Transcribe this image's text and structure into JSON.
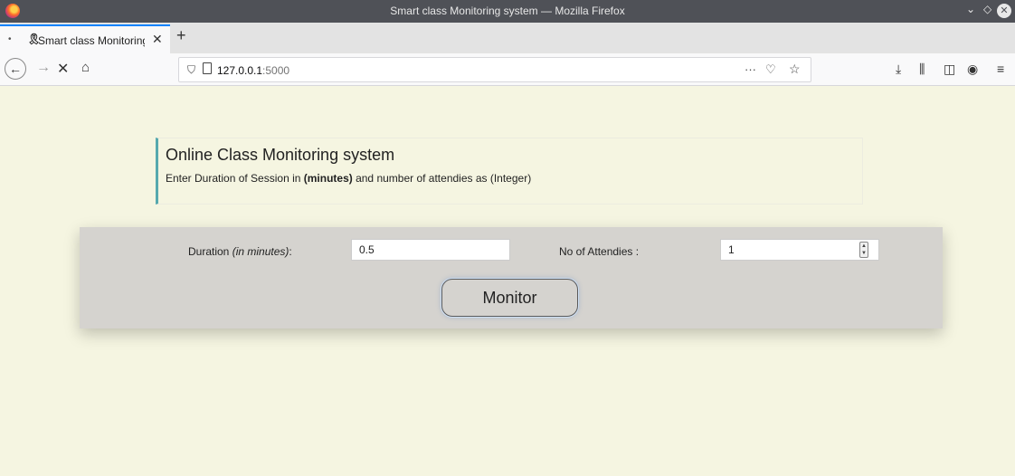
{
  "window": {
    "title": "Smart class Monitoring system — Mozilla Firefox"
  },
  "tabs": [
    {
      "label": "Smart class Monitoring",
      "active": true
    }
  ],
  "navbar": {
    "url_host": "127.0.0.1",
    "url_port": ":5000"
  },
  "page": {
    "heading": "Online Class Monitoring system",
    "instructions_pre": "Enter Duration of Session in ",
    "instructions_bold": "(minutes)",
    "instructions_post": " and number of attendies as (Integer)"
  },
  "form": {
    "duration_label": "Duration ",
    "duration_label_italic": "(in minutes)",
    "duration_label_suffix": ":",
    "duration_value": "0.5",
    "attendees_label": "No of Attendies :",
    "attendees_value": "1",
    "submit_label": "Monitor"
  },
  "colors": {
    "page_bg": "#f5f5e1",
    "panel_bg": "#d5d3cf",
    "heading_accent": "#56a9ae"
  }
}
